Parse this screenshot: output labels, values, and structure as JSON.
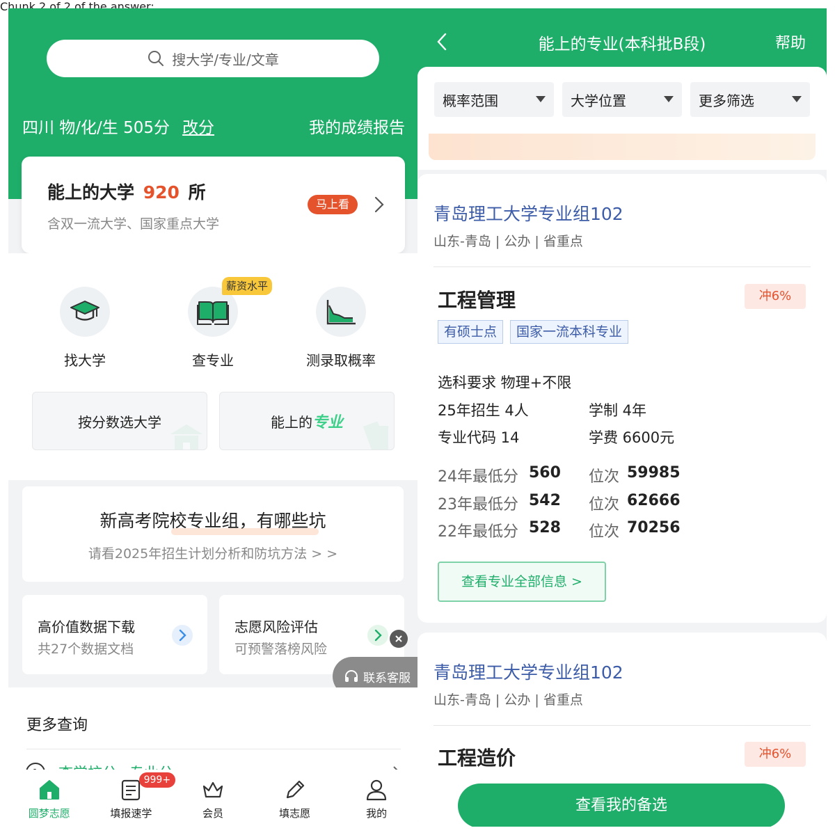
{
  "left": {
    "search": {
      "placeholder": "搜大学/专业/文章"
    },
    "score": {
      "info": "四川 物/化/生 505分",
      "edit": "改分",
      "report": "我的成绩报告"
    },
    "colleges": {
      "prefix": "能上的大学",
      "count": "920",
      "suffix": "所",
      "sub": "含双一流大学、国家重点大学",
      "badge": "马上看"
    },
    "tools": [
      {
        "label": "找大学",
        "icon": "graduation-cap-icon"
      },
      {
        "label": "查专业",
        "icon": "book-icon",
        "tag": "薪资水平"
      },
      {
        "label": "测录取概率",
        "icon": "area-chart-icon"
      }
    ],
    "quick": {
      "by_score": "按分数选大学",
      "majors_prefix": "能上的",
      "majors_accent": "专业"
    },
    "banner": {
      "title": "新高考院校专业组，有哪些坑",
      "sub": "请看2025年招生计划分析和防坑方法 > >"
    },
    "cards": [
      {
        "title": "高价值数据下载",
        "sub": "共27个数据文档"
      },
      {
        "title": "志愿风险评估",
        "sub": "可预警落榜风险"
      }
    ],
    "service": "联系客服",
    "more": {
      "title": "更多查询",
      "item1": "查学校分",
      "item2": "专业分"
    },
    "tabbar": [
      {
        "label": "圆梦志愿",
        "icon": "home-icon"
      },
      {
        "label": "填报速学",
        "icon": "document-icon",
        "badge": "999+"
      },
      {
        "label": "会员",
        "icon": "crown-icon"
      },
      {
        "label": "填志愿",
        "icon": "pencil-icon"
      },
      {
        "label": "我的",
        "icon": "user-icon"
      }
    ]
  },
  "right": {
    "header": {
      "title": "能上的专业(本科批B段)",
      "help": "帮助"
    },
    "filters": [
      "概率范围",
      "大学位置",
      "更多筛选"
    ],
    "groups": [
      {
        "school": "青岛理工大学专业组102",
        "meta": "山东-青岛 | 公办 | 省重点",
        "major": "工程管理",
        "chance": "冲6%",
        "tags": [
          "有硕士点",
          "国家一流本科专业"
        ],
        "subject_req": "选科要求 物理+不限",
        "enroll": "25年招生 4人",
        "duration": "学制 4年",
        "code": "专业代码 14",
        "fee": "学费 6600元",
        "history": [
          {
            "year": "24年最低分",
            "score": "560",
            "rank_label": "位次",
            "rank": "59985"
          },
          {
            "year": "23年最低分",
            "score": "542",
            "rank_label": "位次",
            "rank": "62666"
          },
          {
            "year": "22年最低分",
            "score": "528",
            "rank_label": "位次",
            "rank": "70256"
          }
        ],
        "detail_btn": "查看专业全部信息 >"
      },
      {
        "school": "青岛理工大学专业组102",
        "meta": "山东-青岛 | 公办 | 省重点",
        "major": "工程造价",
        "chance": "冲6%"
      }
    ],
    "cta": "查看我的备选"
  }
}
